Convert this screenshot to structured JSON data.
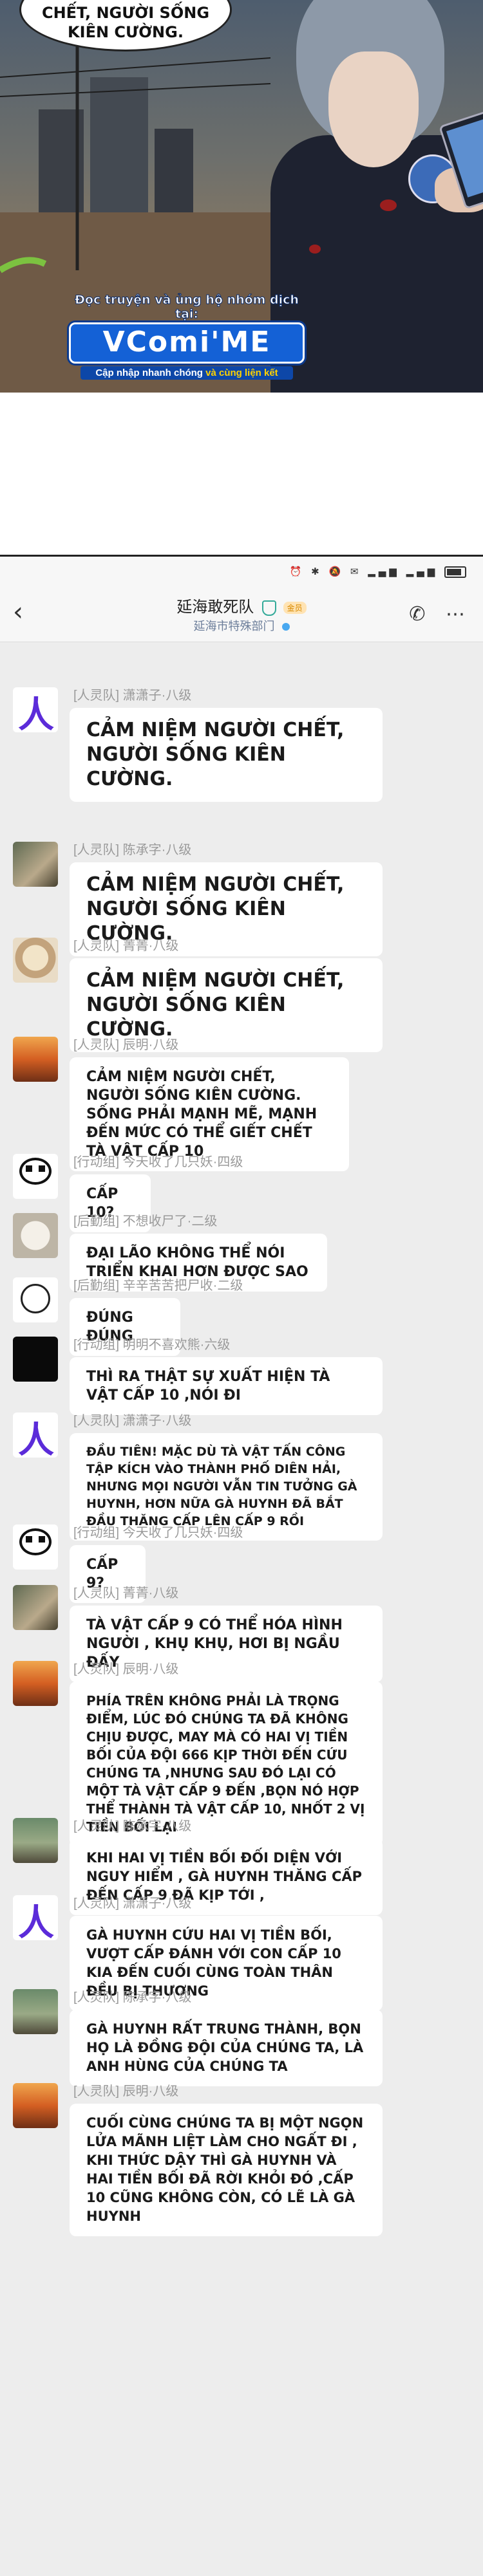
{
  "comic": {
    "speech_line1": "CHẾT, NGƯỜI SỐNG",
    "speech_line2": "KIÊN CƯỜNG.",
    "watermark_top": "Đọc truyện và ủng hộ nhóm dịch tại:",
    "watermark_logo": "VComi'ME",
    "watermark_sub_a": "Cập nhập nhanh chóng",
    "watermark_sub_b": "và cùng liện kết"
  },
  "status_bar": {
    "icons": "⏰ ✱ 🔕 ✉ ▂▄▆ ▂▄▆"
  },
  "chat_header": {
    "back_icon": "‹",
    "title": "延海敢死队",
    "badge": "金员",
    "subtitle": "延海市特殊部门",
    "call_icon": "✆",
    "more_icon": "⋯"
  },
  "messages": [
    {
      "sender": "[人灵队] 潇潇子·八级",
      "text": "CẢM NIỆM NGƯỜI CHẾT, NGƯỜI SỐNG KIÊN CƯỜNG."
    },
    {
      "sender": "[人灵队] 陈承字·八级",
      "text": "CẢM NIỆM NGƯỜI CHẾT, NGƯỜI SỐNG KIÊN CƯỜNG."
    },
    {
      "sender": "[人灵队] 菁菁·八级",
      "text": "CẢM NIỆM NGƯỜI CHẾT, NGƯỜI SỐNG KIÊN CƯỜNG."
    },
    {
      "sender": "[人灵队] 辰明·八级",
      "text": "CẢM NIỆM NGƯỜI CHẾT, NGƯỜI SỐNG KIÊN CƯỜNG. SỐNG PHẢI MẠNH MẼ, MẠNH ĐẾN MỨC CÓ THỂ GIẾT CHẾT TÀ VẬT CẤP 10"
    },
    {
      "sender": "[行动组] 今天收了几只妖·四级",
      "text": "CẤP 10?"
    },
    {
      "sender": "[后勤组] 不想收尸了·二级",
      "text": "ĐẠI LÃO KHÔNG THỂ NÓI TRIỂN KHAI HƠN ĐƯỢC SAO"
    },
    {
      "sender": "[后勤组] 辛辛苦苦把尸收·二级",
      "text": "ĐÚNG ĐÚNG"
    },
    {
      "sender": "[行动组] 明明不喜欢熊·六级",
      "text": "THÌ RA THẬT SỰ XUẤT HIỆN TÀ VẬT CẤP 10 ,NÓI ĐI"
    },
    {
      "sender": "[人灵队] 潇潇子·八级",
      "text": "ĐẦU TIÊN! MẶC DÙ TÀ VẬT TẤN CÔNG TẬP KÍCH VÀO THÀNH PHỐ DIÊN HẢI, NHƯNG MỌI NGƯỜI VẪN TIN TƯỞNG GÀ HUYNH, HƠN NỮA GÀ HUYNH ĐÃ BẮT ĐẦU THĂNG CẤP LÊN CẤP 9 RỒI"
    },
    {
      "sender": "[行动组] 今天收了几只妖·四级",
      "text": "CẤP 9?"
    },
    {
      "sender": "[人灵队] 菁菁·八级",
      "text": "TÀ VẬT CẤP 9 CÓ THỂ HÓA HÌNH NGƯỜI , KHỤ KHỤ, HƠI BỊ NGẦU ĐẤY"
    },
    {
      "sender": "[人灵队] 辰明·八级",
      "text": "PHÍA TRÊN KHÔNG PHẢI LÀ TRỌNG ĐIỂM, LÚC ĐÓ CHÚNG TA ĐÃ KHÔNG CHỊU ĐƯỢC, MAY MÀ CÓ HAI VỊ TIỀN BỐI CỦA ĐỘI 666 KỊP THỜI ĐẾN CỨU CHÚNG TA ,NHƯNG SAU ĐÓ LẠI CÓ MỘT TÀ VẬT CẤP 9 ĐẾN ,BỌN NÓ HỢP THỂ THÀNH TÀ VẬT CẤP 10, NHỐT 2 VỊ TIỀN BỐI LẠI"
    },
    {
      "sender": "[人灵队] 陈承字·八级",
      "text": "KHI HAI VỊ TIỀN BỐI ĐỐI DIỆN VỚI NGUY HIỂM , GÀ HUYNH THĂNG CẤP ĐẾN CẤP 9 ĐÃ KỊP TỚI ,"
    },
    {
      "sender": "[人灵队] 潇潇子·八级",
      "text": "GÀ HUYNH CỨU HAI VỊ TIỀN BỐI, VƯỢT CẤP ĐÁNH VỚI CON CẤP 10 KIA ĐẾN CUỐI CÙNG TOÀN THÂN ĐỀU BỊ THƯƠNG"
    },
    {
      "sender": "[人灵队] 陈承字·八级",
      "text": "GÀ HUYNH RẤT TRUNG THÀNH, BỌN HỌ LÀ ĐỒNG ĐỘI CỦA CHÚNG TA, LÀ ANH HÙNG CỦA CHÚNG TA"
    },
    {
      "sender": "[人灵队] 辰明·八级",
      "text": "CUỐI CÙNG CHÚNG TA BỊ MỘT NGỌN LỬA MÃNH LIỆT LÀM CHO NGẤT ĐI , KHI THỨC DẬY THÌ GÀ HUYNH VÀ HAI TIỀN BỐI ĐÃ RỜI KHỎI ĐÓ ,CẤP 10 CŨNG KHÔNG CÒN, CÓ LẼ LÀ GÀ HUYNH"
    }
  ]
}
